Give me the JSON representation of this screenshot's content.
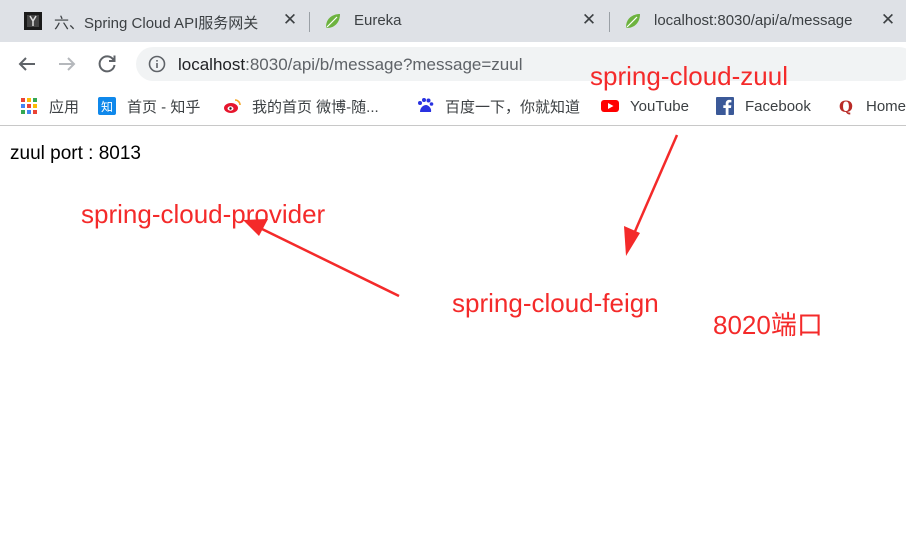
{
  "tabs": [
    {
      "title": "六、Spring Cloud API服务网关",
      "icon": "dark-site-favicon-icon",
      "active": false
    },
    {
      "title": "Eureka",
      "icon": "spring-leaf-icon",
      "active": false
    },
    {
      "title": "localhost:8030/api/a/message",
      "icon": "spring-leaf-icon",
      "active": true
    }
  ],
  "toolbar": {
    "url_host": "localhost",
    "url_rest": ":8030/api/b/message?message=zuul"
  },
  "bookmarks": [
    {
      "label": "应用",
      "icon": "apps-grid-icon"
    },
    {
      "label": "首页 - 知乎",
      "icon": "zhihu-icon"
    },
    {
      "label": "我的首页 微博-随...",
      "icon": "weibo-icon"
    },
    {
      "label": "百度一下，你就知道",
      "icon": "baidu-paw-icon"
    },
    {
      "label": "YouTube",
      "icon": "youtube-icon"
    },
    {
      "label": "Facebook",
      "icon": "facebook-icon"
    },
    {
      "label": "Home",
      "icon": "quora-icon"
    }
  ],
  "page": {
    "text": "zuul port : 8013"
  },
  "annotations": {
    "zuul": "spring-cloud-zuul",
    "provider": "spring-cloud-provider",
    "feign": "spring-cloud-feign",
    "port": "8020端口"
  },
  "colors": {
    "annotation": "#f42a2a",
    "tabstrip": "#dee1e6",
    "omnibox": "#f1f3f4",
    "spring_green": "#6db33f"
  }
}
